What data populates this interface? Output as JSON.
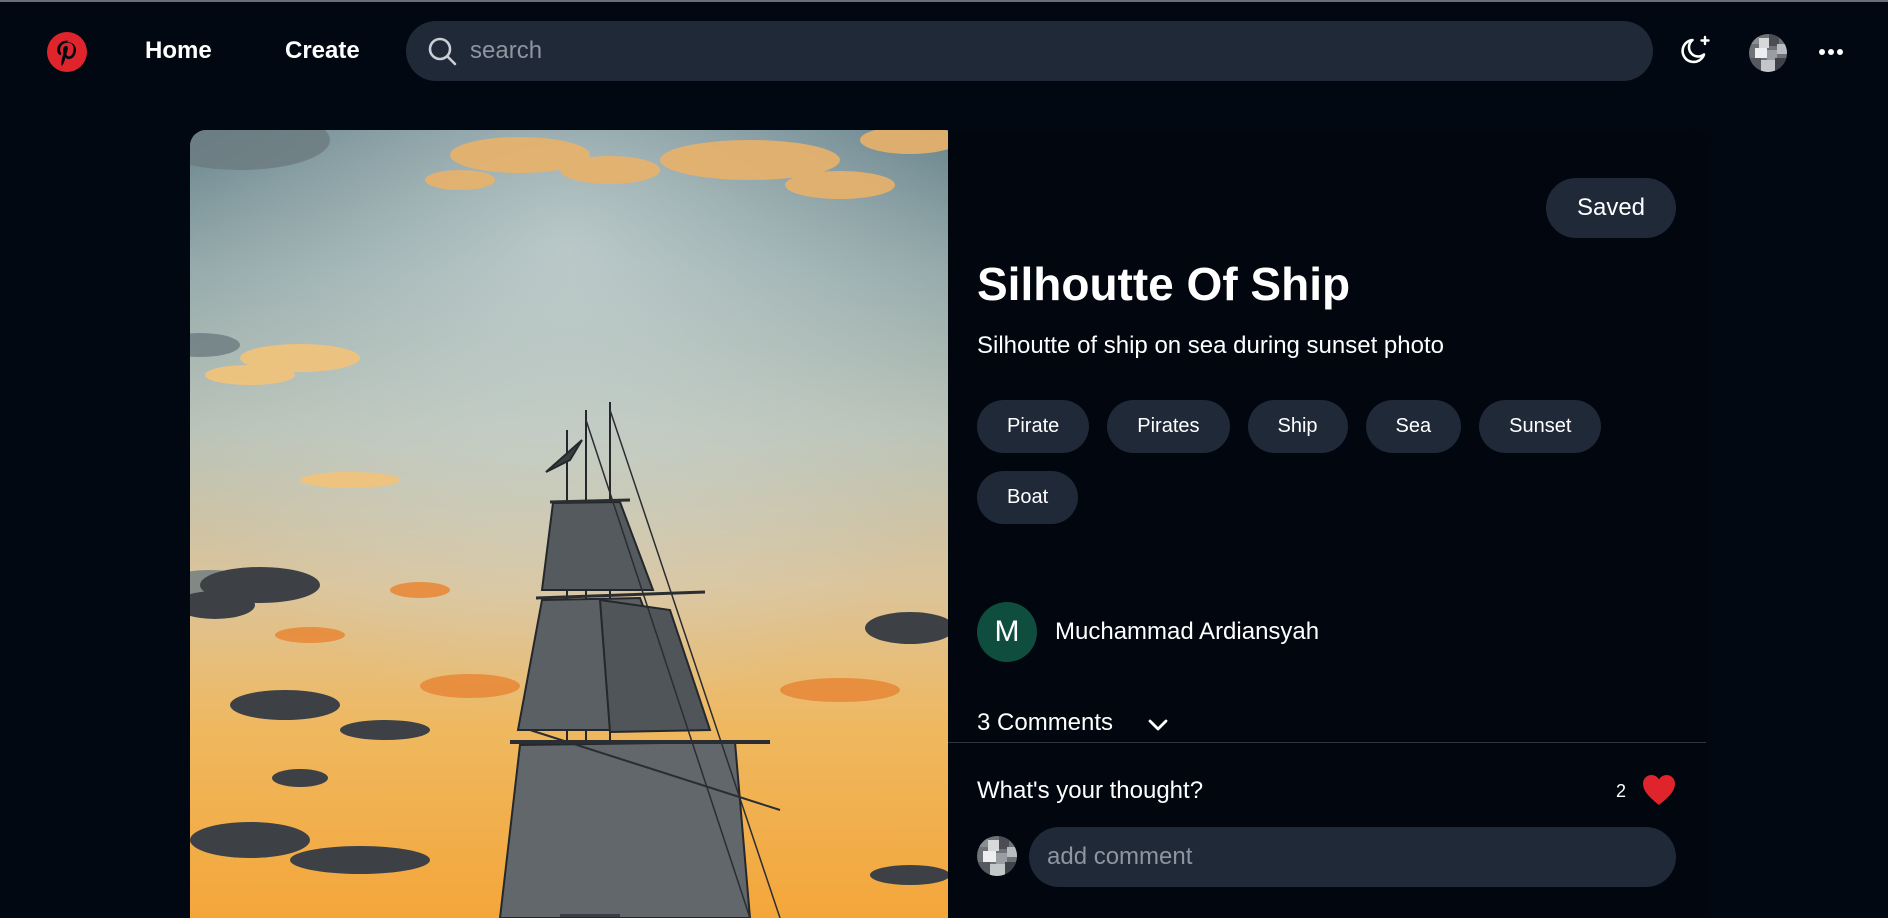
{
  "colors": {
    "background": "#020811",
    "surface": "#1f2937",
    "brand": "#e0242c",
    "author_avatar_bg": "#0f4d3f",
    "like": "#e0242c"
  },
  "header": {
    "logo_icon": "pinterest-logo-icon",
    "nav": {
      "home": "Home",
      "create": "Create"
    },
    "search": {
      "placeholder": "search",
      "value": "",
      "icon": "search-icon"
    },
    "theme_toggle_icon": "moon-icon",
    "avatar_icon": "user-avatar",
    "more_icon": "more-horizontal-icon"
  },
  "pin": {
    "saved_label": "Saved",
    "title": "Silhoutte Of Ship",
    "description": "Silhoutte of ship on sea during sunset photo",
    "tags": [
      "Pirate",
      "Pirates",
      "Ship",
      "Sea",
      "Sunset",
      "Boat"
    ],
    "author": {
      "initial": "M",
      "name": "Muchammad Ardiansyah"
    },
    "comments": {
      "label": "3 Comments",
      "toggle_icon": "chevron-down-icon"
    },
    "thought_prompt": "What's your thought?",
    "likes": "2",
    "comment_placeholder": "add comment",
    "comment_value": ""
  }
}
